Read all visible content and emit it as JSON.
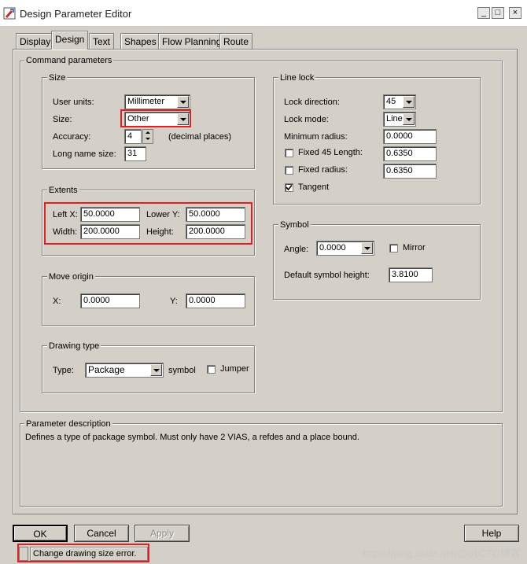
{
  "window": {
    "title": "Design Parameter Editor"
  },
  "window_buttons": {
    "minimize": "_",
    "maximize": "□",
    "close": "×"
  },
  "tabs": [
    "Display",
    "Design",
    "Text",
    "Shapes",
    "Flow Planning",
    "Route"
  ],
  "active_tab": "Design",
  "command_parameters": {
    "title": "Command parameters",
    "size_group": {
      "title": "Size",
      "user_units_label": "User units:",
      "user_units_value": "Millimeter",
      "size_label": "Size:",
      "size_value": "Other",
      "accuracy_label": "Accuracy:",
      "accuracy_value": "4",
      "accuracy_suffix": "(decimal places)",
      "long_name_label": "Long name size:",
      "long_name_value": "31"
    },
    "extents_group": {
      "title": "Extents",
      "left_x_label": "Left X:",
      "left_x_value": "50.0000",
      "lower_y_label": "Lower Y:",
      "lower_y_value": "50.0000",
      "width_label": "Width:",
      "width_value": "200.0000",
      "height_label": "Height:",
      "height_value": "200.0000"
    },
    "move_origin_group": {
      "title": "Move origin",
      "x_label": "X:",
      "x_value": "0.0000",
      "y_label": "Y:",
      "y_value": "0.0000"
    },
    "drawing_type_group": {
      "title": "Drawing type",
      "type_label": "Type:",
      "type_value": "Package",
      "type_suffix": "symbol",
      "jumper_label": "Jumper",
      "jumper_checked": false
    },
    "line_lock_group": {
      "title": "Line lock",
      "lock_direction_label": "Lock direction:",
      "lock_direction_value": "45",
      "lock_mode_label": "Lock mode:",
      "lock_mode_value": "Line",
      "min_radius_label": "Minimum radius:",
      "min_radius_value": "0.0000",
      "fixed45_label": "Fixed 45 Length:",
      "fixed45_value": "0.6350",
      "fixed45_checked": false,
      "fixed_radius_label": "Fixed radius:",
      "fixed_radius_value": "0.6350",
      "fixed_radius_checked": false,
      "tangent_label": "Tangent",
      "tangent_checked": true
    },
    "symbol_group": {
      "title": "Symbol",
      "angle_label": "Angle:",
      "angle_value": "0.0000",
      "mirror_label": "Mirror",
      "mirror_checked": false,
      "default_height_label": "Default symbol height:",
      "default_height_value": "3.8100"
    }
  },
  "parameter_description": {
    "title": "Parameter description",
    "text": "Defines a type of package symbol.  Must only have 2 VIAS, a refdes and a place bound."
  },
  "buttons": {
    "ok": "OK",
    "cancel": "Cancel",
    "apply": "Apply",
    "help": "Help"
  },
  "status": {
    "message": "Change drawing size error."
  },
  "watermark": "https://blog.csdn.net/@51CTO博客",
  "colors": {
    "highlight": "#e02020",
    "dialog_bg": "#d4d0c8"
  }
}
